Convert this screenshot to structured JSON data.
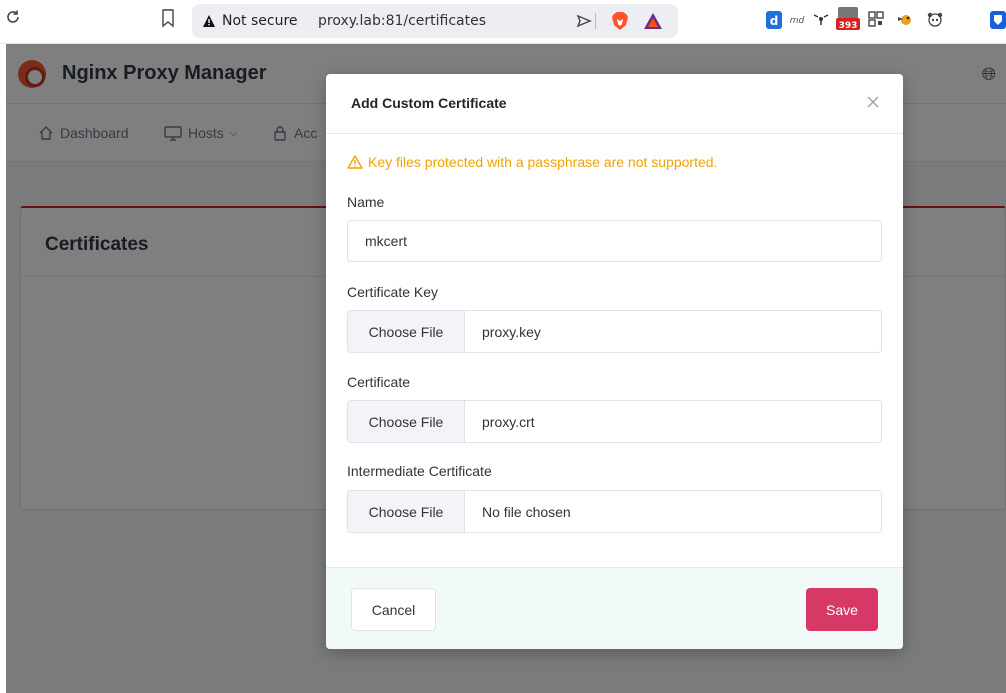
{
  "browser": {
    "security_label": "Not secure",
    "url": "proxy.lab:81/certificates",
    "extension_badge_count": "393"
  },
  "app": {
    "title": "Nginx Proxy Manager",
    "nav": [
      {
        "label": "Dashboard"
      },
      {
        "label": "Hosts"
      },
      {
        "label": "Acc"
      }
    ],
    "card_title": "Certificates"
  },
  "modal": {
    "title": "Add Custom Certificate",
    "warning": "Key files protected with a passphrase are not supported.",
    "name": {
      "label": "Name",
      "value": "mkcert"
    },
    "certificate_key": {
      "label": "Certificate Key",
      "button": "Choose File",
      "file": "proxy.key"
    },
    "certificate": {
      "label": "Certificate",
      "button": "Choose File",
      "file": "proxy.crt"
    },
    "intermediate_certificate": {
      "label": "Intermediate Certificate",
      "button": "Choose File",
      "file": "No file chosen"
    },
    "cancel_label": "Cancel",
    "save_label": "Save"
  },
  "colors": {
    "warning": "#f1a300",
    "save_button": "#d63965",
    "footer_bg": "#f2f9f9",
    "card_accent": "#cd201f"
  },
  "icons": [
    "reload-icon",
    "bookmark-icon",
    "warning-triangle-icon",
    "send-icon",
    "brave-lion-icon",
    "bat-rewards-icon",
    "close-icon",
    "home-icon",
    "monitor-icon",
    "lock-icon",
    "globe-icon"
  ]
}
